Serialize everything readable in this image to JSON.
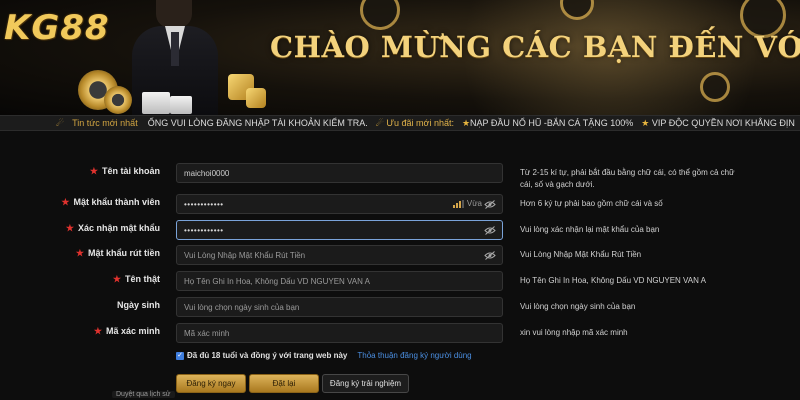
{
  "banner": {
    "logo": "KG88",
    "welcome_text": "CHÀO MỪNG CÁC BẠN ĐẾN VỚI"
  },
  "news": {
    "label": "Tin tức mới nhất",
    "ticker_text": "ỐNG VUI LÒNG ĐĂNG NHẬP TÀI KHOẢN KIỂM TRA.",
    "promo_label": "Ưu đãi mới nhất:",
    "promo_1": "NẠP ĐẦU NỔ HŨ -BẮN CÁ TẶNG 100%",
    "promo_2": "VIP ĐỘC QUYỀN NƠI KHẲNG ĐỊN"
  },
  "form": {
    "username": {
      "label": "Tên tài khoản",
      "value": "maichoi0000",
      "hint": "Từ 2-15 kí tự, phải bắt đầu bằng chữ cái, có thể gồm cả chữ cái, số và gạch dưới."
    },
    "password": {
      "label": "Mật khẩu thành viên",
      "value": "••••••••••••",
      "strength": "Vừa",
      "hint": "Hơn 6 ký tự phải bao gồm chữ cái và số"
    },
    "confirm_password": {
      "label": "Xác nhận mật khẩu",
      "value": "••••••••••••",
      "hint": "Vui lòng xác nhận lại mật khẩu của bạn"
    },
    "withdraw_password": {
      "label": "Mật khẩu rút tiền",
      "placeholder": "Vui Lòng Nhập Mật Khẩu Rút Tiền",
      "hint": "Vui Lòng Nhập Mật Khẩu Rút Tiền"
    },
    "real_name": {
      "label": "Tên thật",
      "placeholder": "Họ Tên Ghi In Hoa, Không Dấu VD  NGUYEN VAN A",
      "hint": "Họ Tên Ghi In Hoa, Không Dấu VD NGUYEN VAN A"
    },
    "birthday": {
      "label": "Ngày sinh",
      "placeholder": "Vui lòng chọn ngày sinh của bạn",
      "hint": "Vui lòng chọn ngày sinh của bạn"
    },
    "captcha": {
      "label": "Mã xác minh",
      "placeholder": "Mã xác minh",
      "hint": "xin vui lòng nhập mã xác minh"
    },
    "agree_text": "Đã đủ 18 tuổi và đồng ý với trang web này",
    "agree_link": "Thỏa thuận đăng ký người dùng",
    "buttons": {
      "register": "Đăng ký ngay",
      "login": "Đặt lại",
      "trial": "Đăng ký trải nghiệm"
    },
    "corner_tag": "Duyệt qua lịch sử"
  },
  "colors": {
    "accent_gold": "#d1a441",
    "required_star": "#e0322e",
    "link_blue": "#4b8fe2",
    "background": "#0d0d0d"
  }
}
